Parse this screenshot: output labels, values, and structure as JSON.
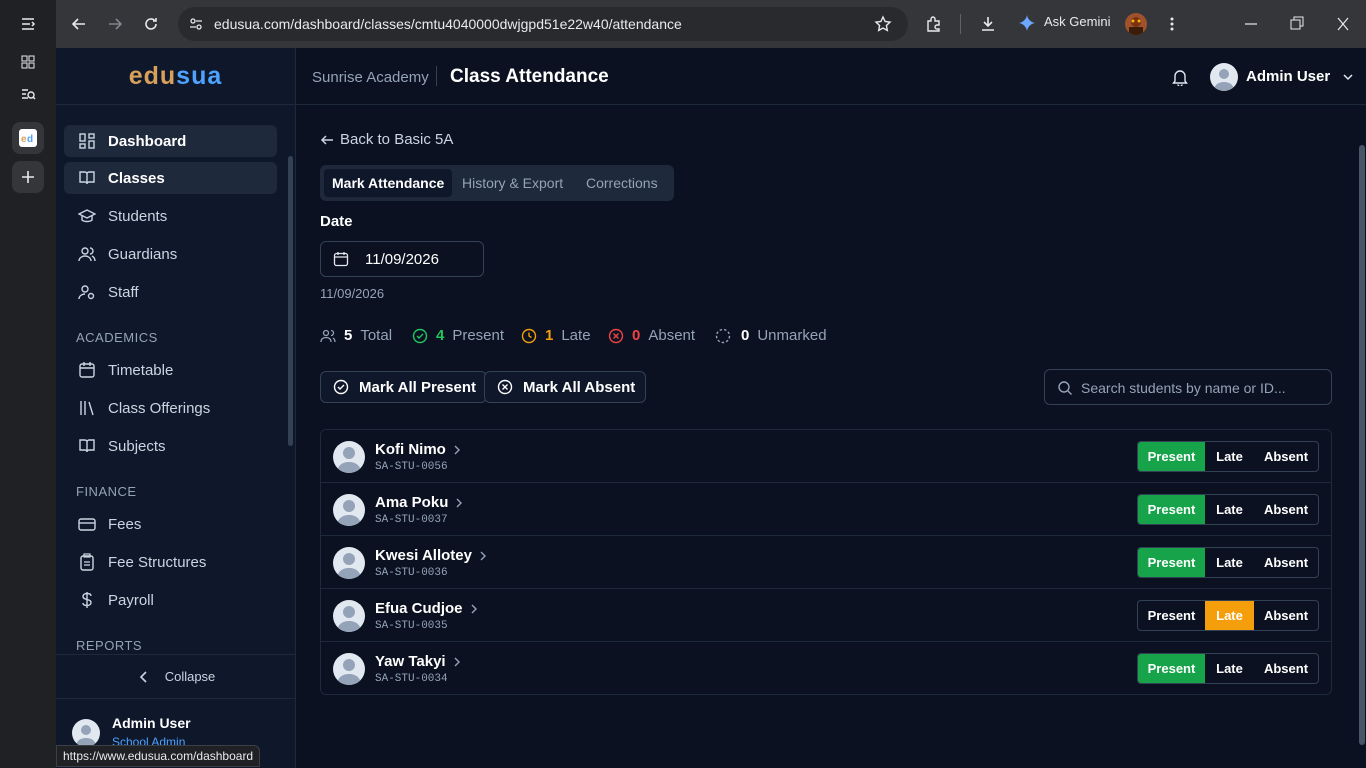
{
  "browser": {
    "url": "edusua.com/dashboard/classes/cmtu4040000dwjgpd51e22w40/attendance",
    "gemini_label": "Ask Gemini",
    "status_url": "https://www.edusua.com/dashboard"
  },
  "brand": {
    "part1": "edu",
    "part2": "sua",
    "color1": "#d8a15b",
    "color2": "#4da3ff"
  },
  "sidebar": {
    "items": [
      {
        "label": "Dashboard",
        "icon": "dashboard-icon"
      },
      {
        "label": "Classes",
        "icon": "book-icon"
      },
      {
        "label": "Students",
        "icon": "graduation-cap-icon"
      },
      {
        "label": "Guardians",
        "icon": "users-icon"
      },
      {
        "label": "Staff",
        "icon": "staff-icon"
      }
    ],
    "academics_label": "ACADEMICS",
    "academics": [
      {
        "label": "Timetable",
        "icon": "calendar-icon"
      },
      {
        "label": "Class Offerings",
        "icon": "library-icon"
      },
      {
        "label": "Subjects",
        "icon": "book-icon"
      }
    ],
    "finance_label": "FINANCE",
    "finance": [
      {
        "label": "Fees",
        "icon": "card-icon"
      },
      {
        "label": "Fee Structures",
        "icon": "clipboard-icon"
      },
      {
        "label": "Payroll",
        "icon": "dollar-icon"
      }
    ],
    "reports_label": "REPORTS",
    "collapse_label": "Collapse",
    "user_name": "Admin User",
    "user_role": "School Admin"
  },
  "header": {
    "school": "Sunrise Academy",
    "title": "Class Attendance",
    "user": "Admin User"
  },
  "main": {
    "back_label": "Back to Basic 5A",
    "tabs": [
      "Mark Attendance",
      "History & Export",
      "Corrections"
    ],
    "date_label": "Date",
    "date_value": "11/09/2026",
    "date_hint": "11/09/2026",
    "stats": {
      "total": "5",
      "total_label": "Total",
      "present": "4",
      "present_label": "Present",
      "late": "1",
      "late_label": "Late",
      "absent": "0",
      "absent_label": "Absent",
      "unmarked": "0",
      "unmarked_label": "Unmarked"
    },
    "mark_all_present": "Mark All Present",
    "mark_all_absent": "Mark All Absent",
    "search_placeholder": "Search students by name or ID...",
    "status_labels": {
      "present": "Present",
      "late": "Late",
      "absent": "Absent"
    },
    "students": [
      {
        "name": "Kofi Nimo",
        "id": "SA-STU-0056",
        "status": "present"
      },
      {
        "name": "Ama Poku",
        "id": "SA-STU-0037",
        "status": "present"
      },
      {
        "name": "Kwesi Allotey",
        "id": "SA-STU-0036",
        "status": "present"
      },
      {
        "name": "Efua Cudjoe",
        "id": "SA-STU-0035",
        "status": "late"
      },
      {
        "name": "Yaw Takyi",
        "id": "SA-STU-0034",
        "status": "present"
      }
    ]
  },
  "colors": {
    "present": "#16a34a",
    "late": "#f59e0b",
    "absent": "#ef4444",
    "accent_green": "#22c55e",
    "accent_orange": "#f59e0b"
  }
}
